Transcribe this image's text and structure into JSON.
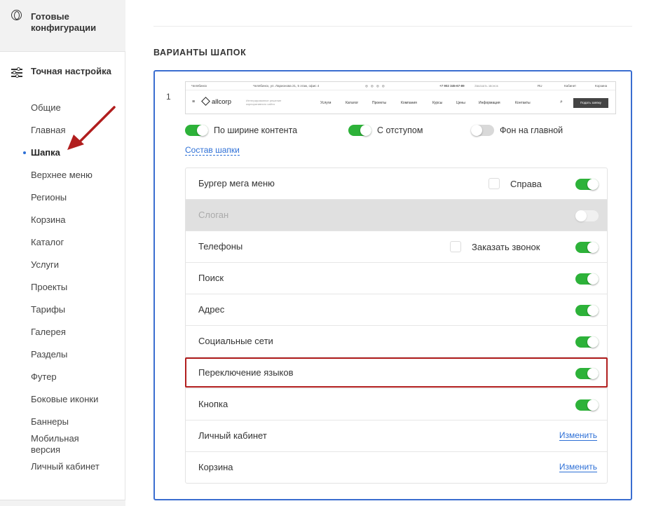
{
  "sidebar": {
    "ready_configs": "Готовые конфигурации",
    "fine_tuning": "Точная настройка",
    "items": [
      {
        "label": "Общие"
      },
      {
        "label": "Главная"
      },
      {
        "label": "Шапка",
        "active": true
      },
      {
        "label": "Верхнее меню"
      },
      {
        "label": "Регионы"
      },
      {
        "label": "Корзина"
      },
      {
        "label": "Каталог"
      },
      {
        "label": "Услуги"
      },
      {
        "label": "Проекты"
      },
      {
        "label": "Тарифы"
      },
      {
        "label": "Галерея"
      },
      {
        "label": "Разделы"
      },
      {
        "label": "Футер"
      },
      {
        "label": "Боковые иконки"
      },
      {
        "label": "Баннеры"
      },
      {
        "label": "Мобильная версия"
      },
      {
        "label": "Личный кабинет"
      }
    ]
  },
  "main": {
    "section_title": "ВАРИАНТЫ ШАПОК",
    "variant_number": "1",
    "preview": {
      "city": "Челябинск",
      "address": "Челябинск, ул. Ларионова 21, 5 этаж, офис 4",
      "phone": "+7 902 345-67-89",
      "callback": "Заказать звонок",
      "lang": "RU",
      "cabinet": "Кабинет",
      "cart": "Корзина",
      "logo": "allcorp",
      "slogan": "Интегрированное решение корпоративного сайта",
      "nav": [
        "Услуги",
        "Каталог",
        "Проекты",
        "Компания",
        "Курсы",
        "Цены",
        "Информация",
        "Контакты"
      ],
      "button": "Подать заявку"
    },
    "options": {
      "full_width": "По ширине контента",
      "with_margin": "С отступом",
      "bg_on_main": "Фон на главной"
    },
    "composition_link": "Состав шапки",
    "rows": [
      {
        "name": "Бургер мега меню",
        "checkbox_label": "Справа",
        "enabled": true
      },
      {
        "name": "Слоган",
        "enabled": false,
        "disabled": true
      },
      {
        "name": "Телефоны",
        "checkbox_label": "Заказать звонок",
        "enabled": true
      },
      {
        "name": "Поиск",
        "enabled": true
      },
      {
        "name": "Адрес",
        "enabled": true
      },
      {
        "name": "Социальные сети",
        "enabled": true
      },
      {
        "name": "Переключение языков",
        "enabled": true,
        "highlighted": true
      },
      {
        "name": "Кнопка",
        "enabled": true
      },
      {
        "name": "Личный кабинет",
        "action": "Изменить"
      },
      {
        "name": "Корзина",
        "action": "Изменить"
      }
    ]
  },
  "colors": {
    "accent": "#2d6fd6",
    "toggle_on": "#2db239",
    "highlight": "#b11e1e",
    "box_border": "#3a6dd0"
  }
}
